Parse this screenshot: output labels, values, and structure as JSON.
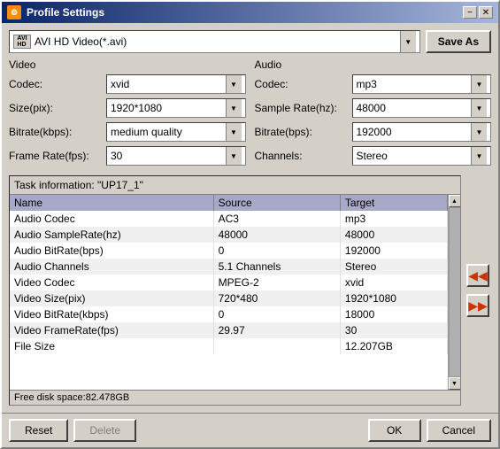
{
  "window": {
    "title": "Profile Settings",
    "icon": "⚙",
    "min_btn": "−",
    "close_btn": "✕"
  },
  "toolbar": {
    "profile_value": "AVI HD Video(*.avi)",
    "save_as_label": "Save As"
  },
  "video_panel": {
    "title": "Video",
    "codec_label": "Codec:",
    "codec_value": "xvid",
    "size_label": "Size(pix):",
    "size_value": "1920*1080",
    "bitrate_label": "Bitrate(kbps):",
    "bitrate_value": "medium quality",
    "framerate_label": "Frame Rate(fps):",
    "framerate_value": "30"
  },
  "audio_panel": {
    "title": "Audio",
    "codec_label": "Codec:",
    "codec_value": "mp3",
    "samplerate_label": "Sample Rate(hz):",
    "samplerate_value": "48000",
    "bitrate_label": "Bitrate(bps):",
    "bitrate_value": "192000",
    "channels_label": "Channels:",
    "channels_value": "Stereo"
  },
  "task_info": {
    "title_prefix": "Task information: \"UP17_1\"",
    "columns": [
      "Name",
      "Source",
      "Target"
    ],
    "rows": [
      [
        "Audio Codec",
        "AC3",
        "mp3"
      ],
      [
        "Audio SampleRate(hz)",
        "48000",
        "48000"
      ],
      [
        "Audio BitRate(bps)",
        "0",
        "192000"
      ],
      [
        "Audio Channels",
        "5.1 Channels",
        "Stereo"
      ],
      [
        "Video Codec",
        "MPEG-2",
        "xvid"
      ],
      [
        "Video Size(pix)",
        "720*480",
        "1920*1080"
      ],
      [
        "Video BitRate(kbps)",
        "0",
        "18000"
      ],
      [
        "Video FrameRate(fps)",
        "29.97",
        "30"
      ],
      [
        "File Size",
        "",
        "12.207GB"
      ]
    ],
    "free_disk": "Free disk space:82.478GB"
  },
  "side_nav": {
    "prev_btn": "◀◀",
    "next_btn": "▶▶"
  },
  "bottom": {
    "reset_label": "Reset",
    "delete_label": "Delete",
    "ok_label": "OK",
    "cancel_label": "Cancel"
  }
}
